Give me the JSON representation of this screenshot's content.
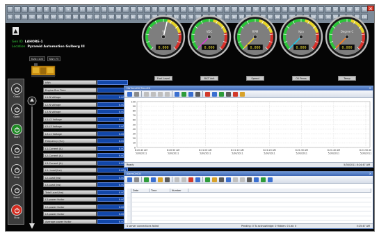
{
  "window": {
    "close_glyph": "✕"
  },
  "channels": {
    "row1": [
      "1",
      "2",
      "3",
      "4",
      "5",
      "6",
      "7",
      "8",
      "9",
      "10",
      "11",
      "12",
      "13",
      "14",
      "15",
      "16",
      "17",
      "18",
      "19",
      "20",
      "21",
      "22",
      "23",
      "24",
      "25",
      "26",
      "27",
      "28",
      "29",
      "30",
      "31",
      "32",
      "33",
      "34",
      "35",
      "36",
      "37",
      "38",
      "39",
      "40",
      "41",
      "42",
      "43",
      "44",
      "45",
      "46",
      "47",
      "48",
      "49",
      "50"
    ],
    "row2": [
      "51",
      "52",
      "53",
      "54",
      "55",
      "56",
      "57",
      "58",
      "59",
      "60",
      "61",
      "62",
      "63",
      "64",
      "65",
      "66",
      "67",
      "68",
      "69",
      "70",
      "71",
      "72",
      "73",
      "74",
      "75",
      "76",
      "77",
      "78",
      "79",
      "80",
      "81",
      "82",
      "83",
      "84",
      "85",
      "86",
      "87",
      "88",
      "89",
      "90",
      "91",
      "92",
      "93",
      "94",
      "95",
      "96",
      "97",
      "98",
      "99",
      "100"
    ]
  },
  "site": {
    "id_label": "Gen ID",
    "id_value": "LAHORE-1",
    "location_label": "Location",
    "location_value": "Pyramid Automation Gulberg III",
    "kva_left": "KVA=100",
    "kva_right": "KW=75"
  },
  "gauges": [
    {
      "name": "fuel-level-gauge",
      "label": "Fuel Level",
      "unit": "%",
      "level": 0.55,
      "readout": "0.000",
      "needle": "#ffffff"
    },
    {
      "name": "bat-volt-gauge",
      "label": "BAT Volt",
      "unit": "VDC",
      "level": 0.0,
      "readout": "0.000",
      "needle": "#d93bd3"
    },
    {
      "name": "speed-gauge",
      "label": "Speed",
      "unit": "RPM",
      "level": 0.0,
      "readout": "0.000",
      "needle": "#f3d423"
    },
    {
      "name": "oil-press-gauge",
      "label": "Oil Press",
      "unit": "Kpa",
      "level": 0.0,
      "readout": "0.000",
      "needle": "#1ec7e8"
    },
    {
      "name": "temp-gauge",
      "label": "Temp",
      "unit": "Degree C",
      "level": 0.0,
      "readout": "0.000",
      "needle": "#ff7a1a"
    }
  ],
  "buttons": [
    {
      "name": "close-button",
      "label": "Close",
      "color": "#2d2d2d"
    },
    {
      "name": "open-button",
      "label": "Open",
      "color": "#2d2d2d"
    },
    {
      "name": "start-button",
      "label": "Start",
      "color": "#1e8a24"
    },
    {
      "name": "auto-button",
      "label": "Auto",
      "color": "#2d2d2d"
    },
    {
      "name": "stop-button",
      "label": "Stop",
      "color": "#2d2d2d"
    },
    {
      "name": "hand-button",
      "label": "Hand",
      "color": "#2d2d2d"
    },
    {
      "name": "stop-emergency-button",
      "label": "Stop",
      "color": "#d22a1e"
    }
  ],
  "params": [
    {
      "name": "kWh",
      "value": ""
    },
    {
      "name": "Engine Run Time",
      "value": ""
    },
    {
      "name": "L1-N Voltage",
      "value": "0.000"
    },
    {
      "name": "L2-N Voltage",
      "value": "0.000"
    },
    {
      "name": "L3-N Voltage",
      "value": "0.000"
    },
    {
      "name": "L1-L2 Voltage",
      "value": "0.000"
    },
    {
      "name": "L2-L3 Voltage",
      "value": "0.000"
    },
    {
      "name": "L3-L1 Voltage",
      "value": "0.000"
    },
    {
      "name": "Frequency (Hz.)",
      "value": "0.000"
    },
    {
      "name": "L1-Current (A)",
      "value": "0.000"
    },
    {
      "name": "L2-Current (A)",
      "value": "0.000"
    },
    {
      "name": "L3-Current (A)",
      "value": "0.000"
    },
    {
      "name": "L1- Load (kw)",
      "value": "0.000"
    },
    {
      "name": "L2-Load (kw)",
      "value": "0.000"
    },
    {
      "name": "L3-Load (kw)",
      "value": "0.000"
    },
    {
      "name": "Total Load (kw)",
      "value": "0.000"
    },
    {
      "name": "L1-power factor",
      "value": "0.000"
    },
    {
      "name": "L2-power factor",
      "value": "0.000"
    },
    {
      "name": "L3-power factor",
      "value": "0.000"
    },
    {
      "name": "Average power factor",
      "value": "0.000"
    }
  ],
  "trend": {
    "title": "HisTrendCtl/TrendCtl",
    "status_left": "Ready",
    "status_right": "5/30/2011 8:24:47 AM",
    "y_ticks": [
      "100",
      "90",
      "80",
      "70",
      "60",
      "50",
      "40",
      "30",
      "20",
      "10",
      "0"
    ],
    "x_ticks": [
      [
        "8:20:40 AM",
        "5/30/2011"
      ],
      [
        "8:20:50 AM",
        "5/30/2011"
      ],
      [
        "8:21:00 AM",
        "5/30/2011"
      ],
      [
        "8:21:10 AM",
        "5/30/2011"
      ],
      [
        "8:21:20 AM",
        "5/30/2011"
      ],
      [
        "8:21:30 AM",
        "5/30/2011"
      ],
      [
        "8:21:40 AM",
        "5/30/2011"
      ],
      [
        "8:21:50 AM",
        "5/30/2011"
      ]
    ],
    "toolbar_colors": [
      "#3a6fd0",
      "#8a8a8a",
      "#bfbfbf",
      "#bfbfbf",
      "#bfbfbf",
      "#bfbfbf",
      "#3a6fd0",
      "#2e9c3a",
      "#3a6fd0",
      "#5a5a5a",
      "#d23a2a",
      "#3a6fd0",
      "#2e9c3a",
      "#5a5a5a",
      "#d23a2a",
      "#d8a22a"
    ]
  },
  "events": {
    "title": "AlarmCtrlCtl",
    "columns": [
      "Date",
      "Time",
      "Number"
    ],
    "status_left": "4 server connections failed",
    "status_mid": "Pending: 0    To acknowledge: 0    Hidden: 0    List: 0",
    "status_right": "5:25:47 AM",
    "toolbar_colors": [
      "#3a6fd0",
      "#8a8a8a",
      "#2e9c3a",
      "#3a6fd0",
      "#d8a22a",
      "#5a5a5a",
      "#bfbfbf",
      "#bfbfbf",
      "#d23a2a",
      "#3a6fd0",
      "#2e9c3a",
      "#d8a22a",
      "#5a5a5a",
      "#3a6fd0",
      "#bfbfbf",
      "#bfbfbf",
      "#5a5a5a",
      "#3a6fd0",
      "#2e9c3a",
      "#3a6fd0"
    ]
  }
}
